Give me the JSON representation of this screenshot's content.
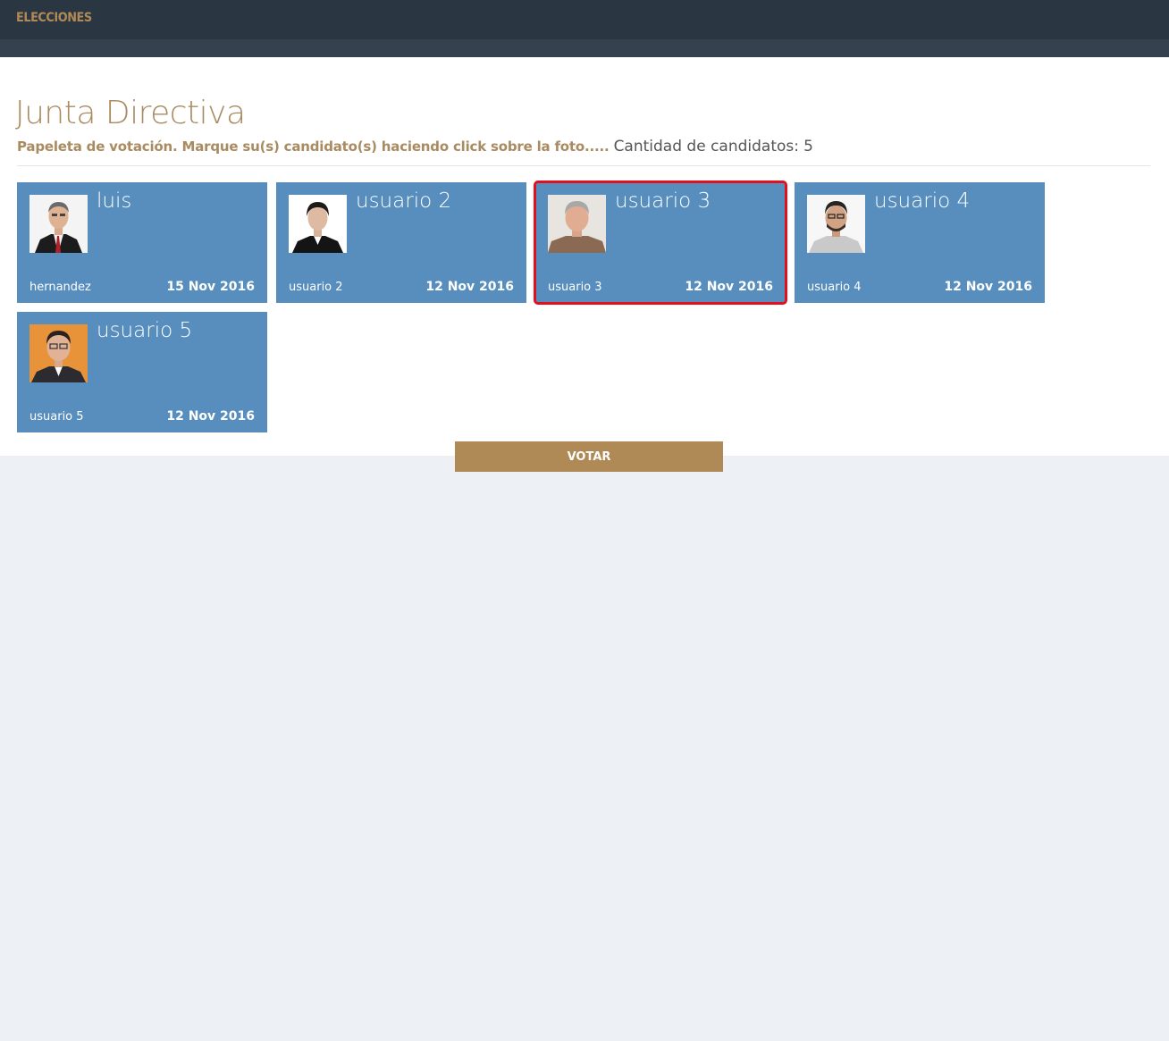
{
  "header": {
    "brand": "ELECCIONES"
  },
  "page": {
    "title": "Junta Directiva",
    "instruction": "Papeleta de votación. Marque su(s) candidato(s) haciendo click sobre la foto.....",
    "count_label": "Cantidad de candidatos:",
    "count_value": "5"
  },
  "candidates": [
    {
      "name": "luis",
      "subtitle": "hernandez",
      "date": "15 Nov 2016",
      "selected": false
    },
    {
      "name": "usuario 2",
      "subtitle": "usuario 2",
      "date": "12 Nov 2016",
      "selected": false
    },
    {
      "name": "usuario 3",
      "subtitle": "usuario 3",
      "date": "12 Nov 2016",
      "selected": true
    },
    {
      "name": "usuario 4",
      "subtitle": "usuario 4",
      "date": "12 Nov 2016",
      "selected": false
    },
    {
      "name": "usuario 5",
      "subtitle": "usuario 5",
      "date": "12 Nov 2016",
      "selected": false
    }
  ],
  "actions": {
    "vote_label": "VOTAR"
  },
  "colors": {
    "topbar": "#2b3643",
    "accent": "#b08a56",
    "card": "#578ebe",
    "selected_border": "#e0101e"
  }
}
